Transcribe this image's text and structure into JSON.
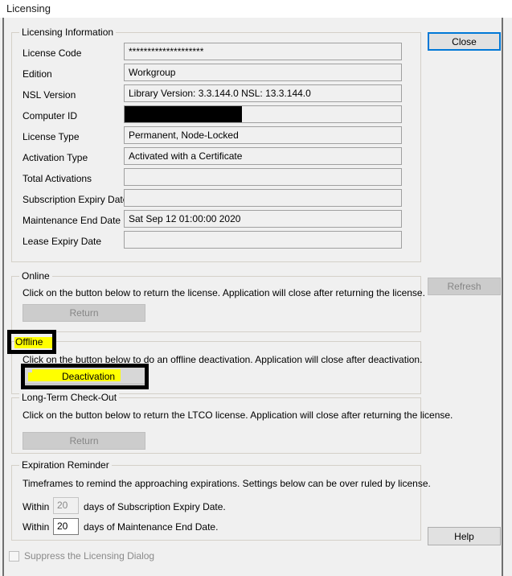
{
  "window": {
    "title": "Licensing"
  },
  "licensing_information": {
    "group_label": "Licensing Information",
    "fields": [
      {
        "label": "License Code",
        "value": "********************",
        "redacted": false
      },
      {
        "label": "Edition",
        "value": "Workgroup",
        "redacted": false
      },
      {
        "label": "NSL Version",
        "value": "Library Version: 3.3.144.0 NSL: 13.3.144.0",
        "redacted": false
      },
      {
        "label": "Computer ID",
        "value": "",
        "redacted": true
      },
      {
        "label": "License Type",
        "value": "Permanent, Node-Locked",
        "redacted": false
      },
      {
        "label": "Activation Type",
        "value": "Activated with a Certificate",
        "redacted": false
      },
      {
        "label": "Total Activations",
        "value": "",
        "redacted": false
      },
      {
        "label": "Subscription Expiry Date",
        "value": "",
        "redacted": false
      },
      {
        "label": "Maintenance End Date",
        "value": "Sat Sep 12 01:00:00 2020",
        "redacted": false
      },
      {
        "label": "Lease Expiry Date",
        "value": "",
        "redacted": false
      }
    ]
  },
  "online": {
    "group_label": "Online",
    "description": "Click on the button below to return the license. Application will close after returning the license.",
    "return_button": "Return"
  },
  "offline": {
    "group_label": "Offline",
    "description": "Click on the button below to do an offline deactivation. Application will close after deactivation.",
    "deactivation_button": "Deactivation"
  },
  "long_term_checkout": {
    "group_label": "Long-Term Check-Out",
    "description": "Click on the button below to return the LTCO license. Application will close after returning the license.",
    "return_button": "Return"
  },
  "expiration_reminder": {
    "group_label": "Expiration Reminder",
    "description": "Timeframes to remind the approaching expirations. Settings below can be over ruled by license.",
    "rows": [
      {
        "prefix": "Within",
        "value": "20",
        "suffix": "days of Subscription Expiry Date."
      },
      {
        "prefix": "Within",
        "value": "20",
        "suffix": "days of Maintenance End Date."
      }
    ]
  },
  "suppress": {
    "label": "Suppress the Licensing Dialog"
  },
  "side_buttons": {
    "close": "Close",
    "refresh": "Refresh",
    "help": "Help"
  },
  "colors": {
    "focus_border": "#0078d7",
    "highlight": "#ffff00",
    "annotation": "#000000",
    "dialog_face": "#f0f0f0",
    "field_border": "#a0a0a0",
    "disabled_text": "#868686"
  }
}
